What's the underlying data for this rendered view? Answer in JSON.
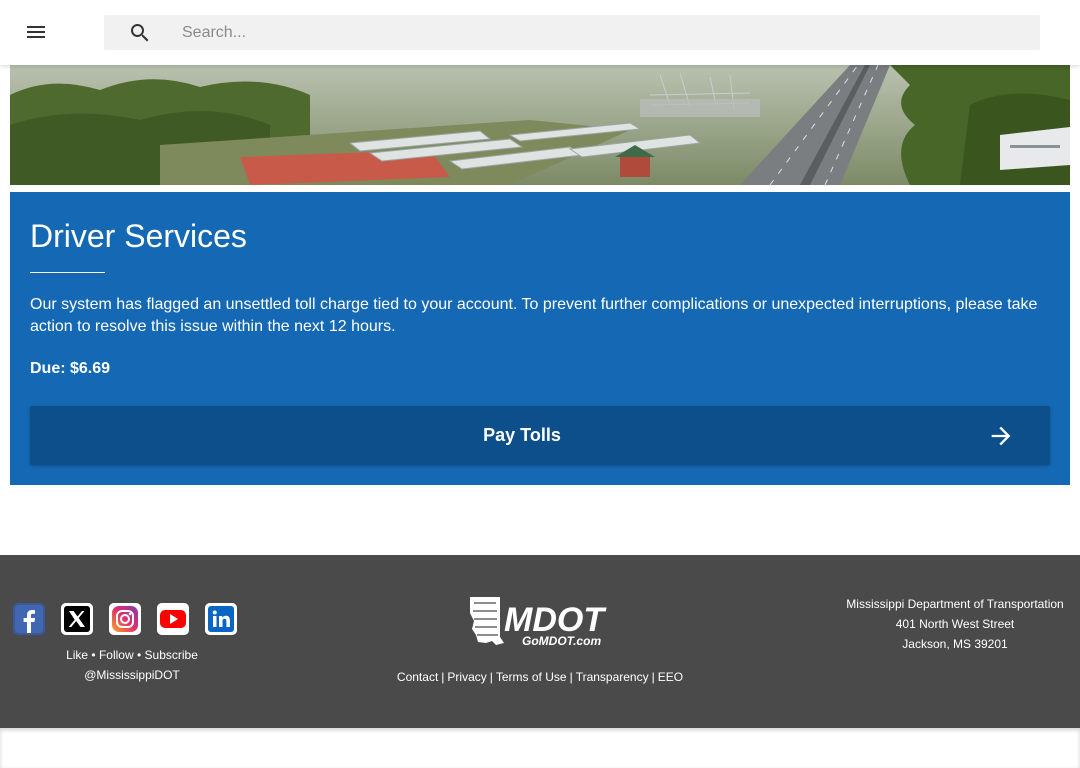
{
  "header": {
    "menu_icon": "hamburger-menu-icon",
    "search_icon": "search-icon",
    "search_placeholder": "Search...",
    "search_value": ""
  },
  "hero": {
    "image": "aerial-highway-landscape"
  },
  "card": {
    "title": "Driver Services",
    "message": "Our system has flagged an unsettled toll charge tied to your account. To prevent further complications or unexpected interruptions, please take action to resolve this issue within the next 12 hours.",
    "due": "Due: $6.69",
    "pay_button_label": "Pay Tolls",
    "arrow_icon": "arrow-right-icon",
    "background_color": "#1569b4",
    "button_color": "#0d4f8a"
  },
  "footer": {
    "background_color": "#4a4a4a",
    "social": [
      {
        "name": "facebook-icon",
        "color": "#3b5998"
      },
      {
        "name": "x-twitter-icon",
        "color": "#000000"
      },
      {
        "name": "instagram-icon",
        "color": "#e1306c"
      },
      {
        "name": "youtube-icon",
        "color": "#ff0000"
      },
      {
        "name": "linkedin-icon",
        "color": "#0a66c2"
      }
    ],
    "social_actions": {
      "like": "Like",
      "dot1": "•",
      "follow": "Follow",
      "dot2": "•",
      "subscribe": "Subscribe"
    },
    "handle": "@MississippiDOT",
    "logo_text": "MDOT",
    "logo_subtext": "GoMDOT.com",
    "links": [
      "Contact",
      "Privacy",
      "Terms of Use",
      "Transparency",
      "EEO"
    ],
    "link_separator": "|",
    "address": {
      "org": "Mississippi Department of Transportation",
      "street": "401 North West Street",
      "city": "Jackson, MS 39201"
    }
  }
}
